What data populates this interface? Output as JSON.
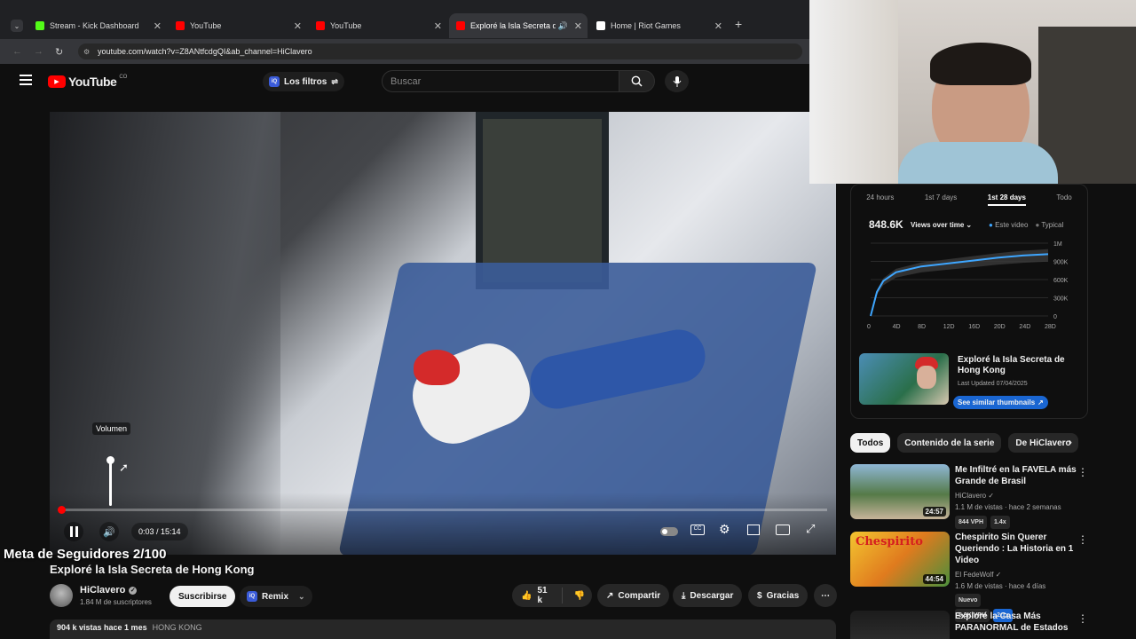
{
  "browser": {
    "tabs": [
      {
        "label": "Stream - Kick Dashboard",
        "color": "#53fc18"
      },
      {
        "label": "YouTube",
        "color": "#ff0000"
      },
      {
        "label": "YouTube",
        "color": "#ff0000"
      },
      {
        "label": "Exploré la Isla Secreta de H",
        "color": "#ff0000"
      },
      {
        "label": "Home | Riot Games",
        "color": "#ffffff"
      }
    ],
    "url": "youtube.com/watch?v=Z8ANtfcdgQI&ab_channel=HiClavero"
  },
  "header": {
    "logo": "YouTube",
    "country": "CO",
    "filters_label": "Los filtros",
    "search_placeholder": "Buscar"
  },
  "player": {
    "volume_tooltip": "Volumen",
    "time": "0:03 / 15:14",
    "progress": 0.003,
    "volume_level": 1.0
  },
  "overlay": {
    "follower_goal": "Meta de Seguidores 2/100"
  },
  "video": {
    "title": "Exploré la Isla Secreta de Hong Kong",
    "channel": "HiClavero",
    "subscribers": "1.84 M de suscriptores",
    "subscribe_label": "Suscribirse",
    "remix_label": "Remix",
    "likes": "51 k",
    "share_label": "Compartir",
    "download_label": "Descargar",
    "thanks_label": "Gracias",
    "meta": "904 k vistas  hace 1 mes",
    "tag": "HONG KONG"
  },
  "analytics": {
    "ranges": [
      "24 hours",
      "1st 7 days",
      "1st 28 days",
      "Todo"
    ],
    "selected_range": "1st 28 days",
    "views": "848.6K",
    "dropdown": "Views over time",
    "legend_this": "Este video",
    "legend_typical": "Typical",
    "accent": "#3ea6ff",
    "chart_data": {
      "type": "area",
      "x_tick_labels": [
        "0",
        "4D",
        "8D",
        "12D",
        "16D",
        "20D",
        "24D",
        "28D"
      ],
      "y_tick_labels": [
        "1M",
        "900K",
        "600K",
        "300K",
        "0"
      ],
      "series": [
        {
          "name": "Este video",
          "x": [
            0,
            1,
            2,
            4,
            8,
            12,
            16,
            20,
            24,
            28
          ],
          "y": [
            0,
            330000,
            480000,
            600000,
            680000,
            720000,
            760000,
            800000,
            830000,
            848600
          ]
        }
      ]
    },
    "card_title": "Exploré la Isla Secreta de Hong Kong",
    "card_updated": "Last Updated 07/04/2025",
    "similar_label": "See similar thumbnails"
  },
  "rec_tabs": [
    "Todos",
    "Contenido de la serie",
    "De HiClavero"
  ],
  "recommendations": [
    {
      "title": "Me Infiltré en la FAVELA más Grande de Brasil",
      "channel": "HiClavero",
      "stats": "1.1 M de vistas · hace 2 semanas",
      "vph": "844 VPH",
      "multiplier": "1.4x",
      "duration": "24:57"
    },
    {
      "title": "Chespirito Sin Querer Queriendo : La Historia en 1 Video",
      "channel": "El FedeWolf",
      "stats": "1.6 M de vistas · hace 4 días",
      "new": "Nuevo",
      "vph": "5.3K VPH",
      "multiplier": "2.1x",
      "duration": "44:54",
      "thumb_text": "Chespirito"
    },
    {
      "title": "Exploré la Casa Más PARANORMAL de Estados",
      "channel": "",
      "stats": "",
      "duration": ""
    }
  ]
}
